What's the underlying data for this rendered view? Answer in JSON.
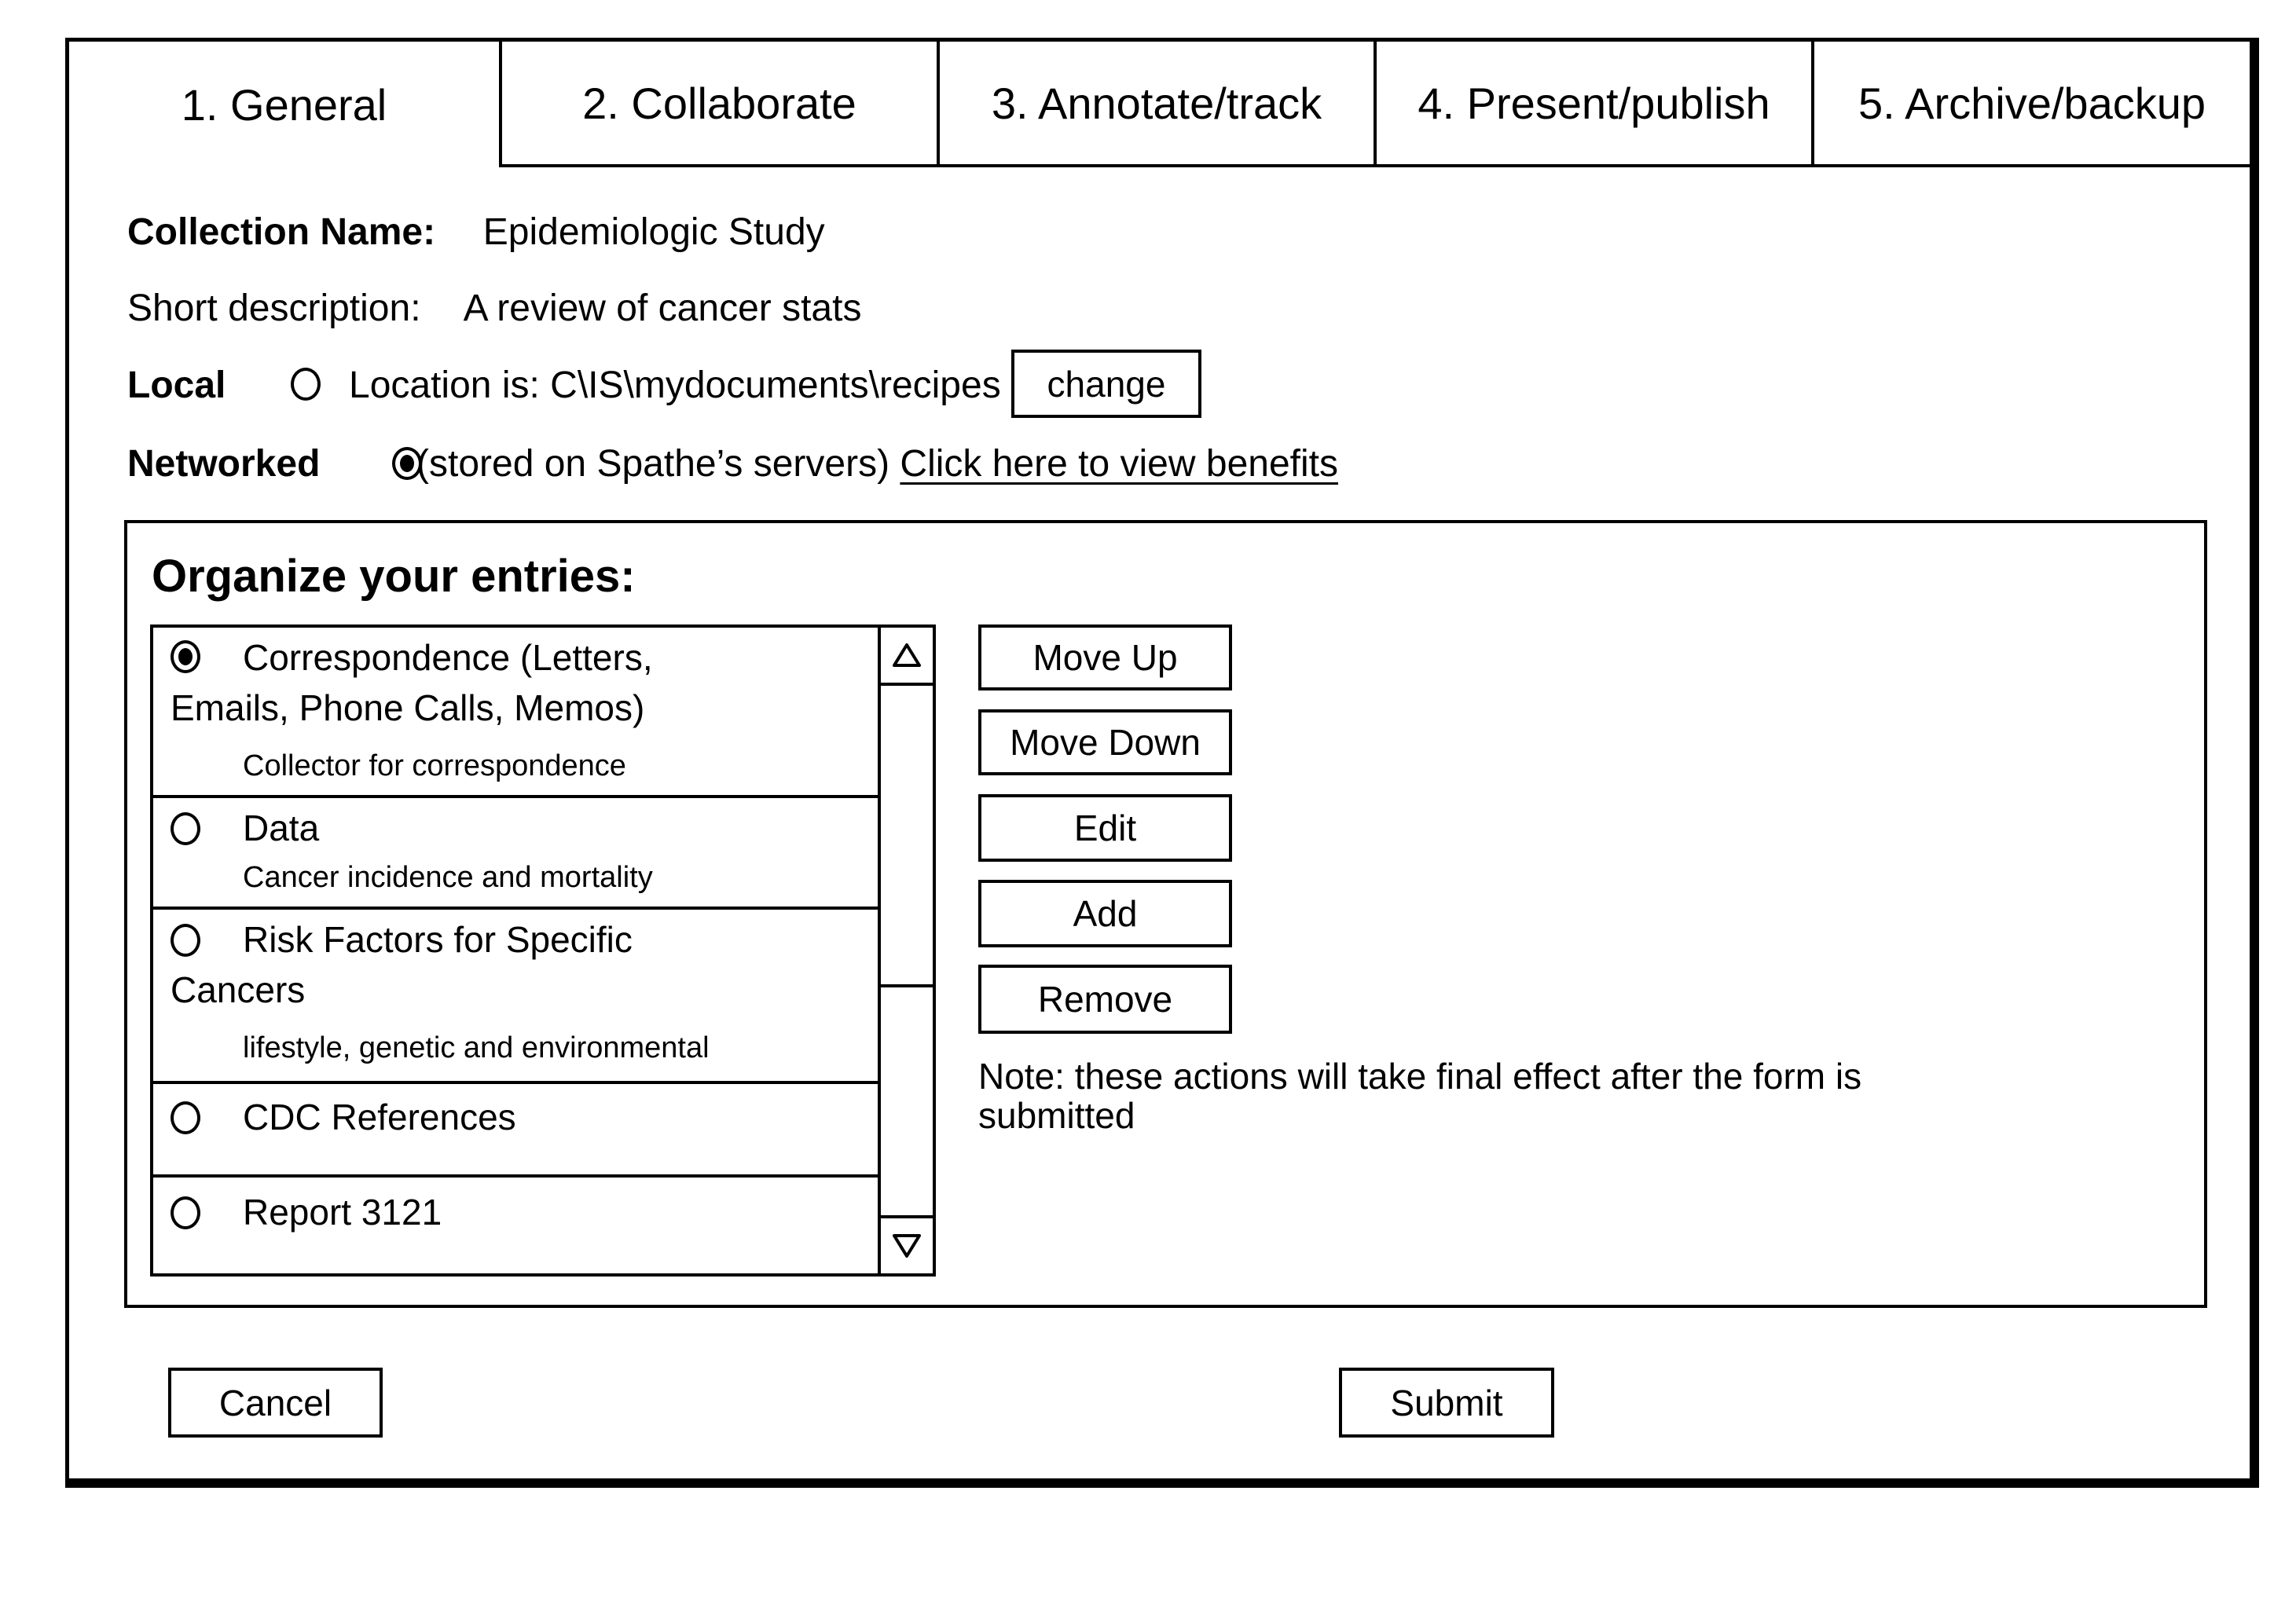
{
  "tabs": [
    {
      "label": "1. General",
      "active": true
    },
    {
      "label": "2. Collaborate",
      "active": false
    },
    {
      "label": "3. Annotate/track",
      "active": false
    },
    {
      "label": "4. Present/publish",
      "active": false
    },
    {
      "label": "5. Archive/backup",
      "active": false
    }
  ],
  "general": {
    "collection_name_label": "Collection Name:",
    "collection_name_value": "Epidemiologic Study",
    "short_description_label": "Short description:",
    "short_description_value": "A review of cancer stats",
    "local_label": "Local",
    "local_selected": false,
    "local_location_text": "Location is: C\\IS\\mydocuments\\recipes",
    "change_button": "change",
    "networked_label": "Networked",
    "networked_selected": true,
    "networked_text": "(stored on Spathe’s servers)",
    "benefits_link": "Click here to view benefits"
  },
  "organize": {
    "title": "Organize your entries:",
    "entries": [
      {
        "title_line1": "Correspondence (Letters,",
        "title_line2": "Emails, Phone Calls, Memos)",
        "subtitle": "Collector for correspondence",
        "selected": true
      },
      {
        "title_line1": "Data",
        "title_line2": "",
        "subtitle": "Cancer incidence and mortality",
        "selected": false
      },
      {
        "title_line1": "Risk Factors for Specific",
        "title_line2": "Cancers",
        "subtitle": "lifestyle, genetic and environmental",
        "selected": false
      },
      {
        "title_line1": "CDC References",
        "title_line2": "",
        "subtitle": "",
        "selected": false
      },
      {
        "title_line1": "Report 3121",
        "title_line2": "",
        "subtitle": "",
        "selected": false
      }
    ],
    "scroll_up_icon": "triangle-up-outline",
    "scroll_down_icon": "triangle-down-outline",
    "buttons": {
      "move_up": "Move Up",
      "move_down": "Move Down",
      "edit": "Edit",
      "add": "Add",
      "remove": "Remove"
    },
    "note": "Note: these actions will take final effect after the form is submitted"
  },
  "footer": {
    "cancel": "Cancel",
    "submit": "Submit"
  }
}
